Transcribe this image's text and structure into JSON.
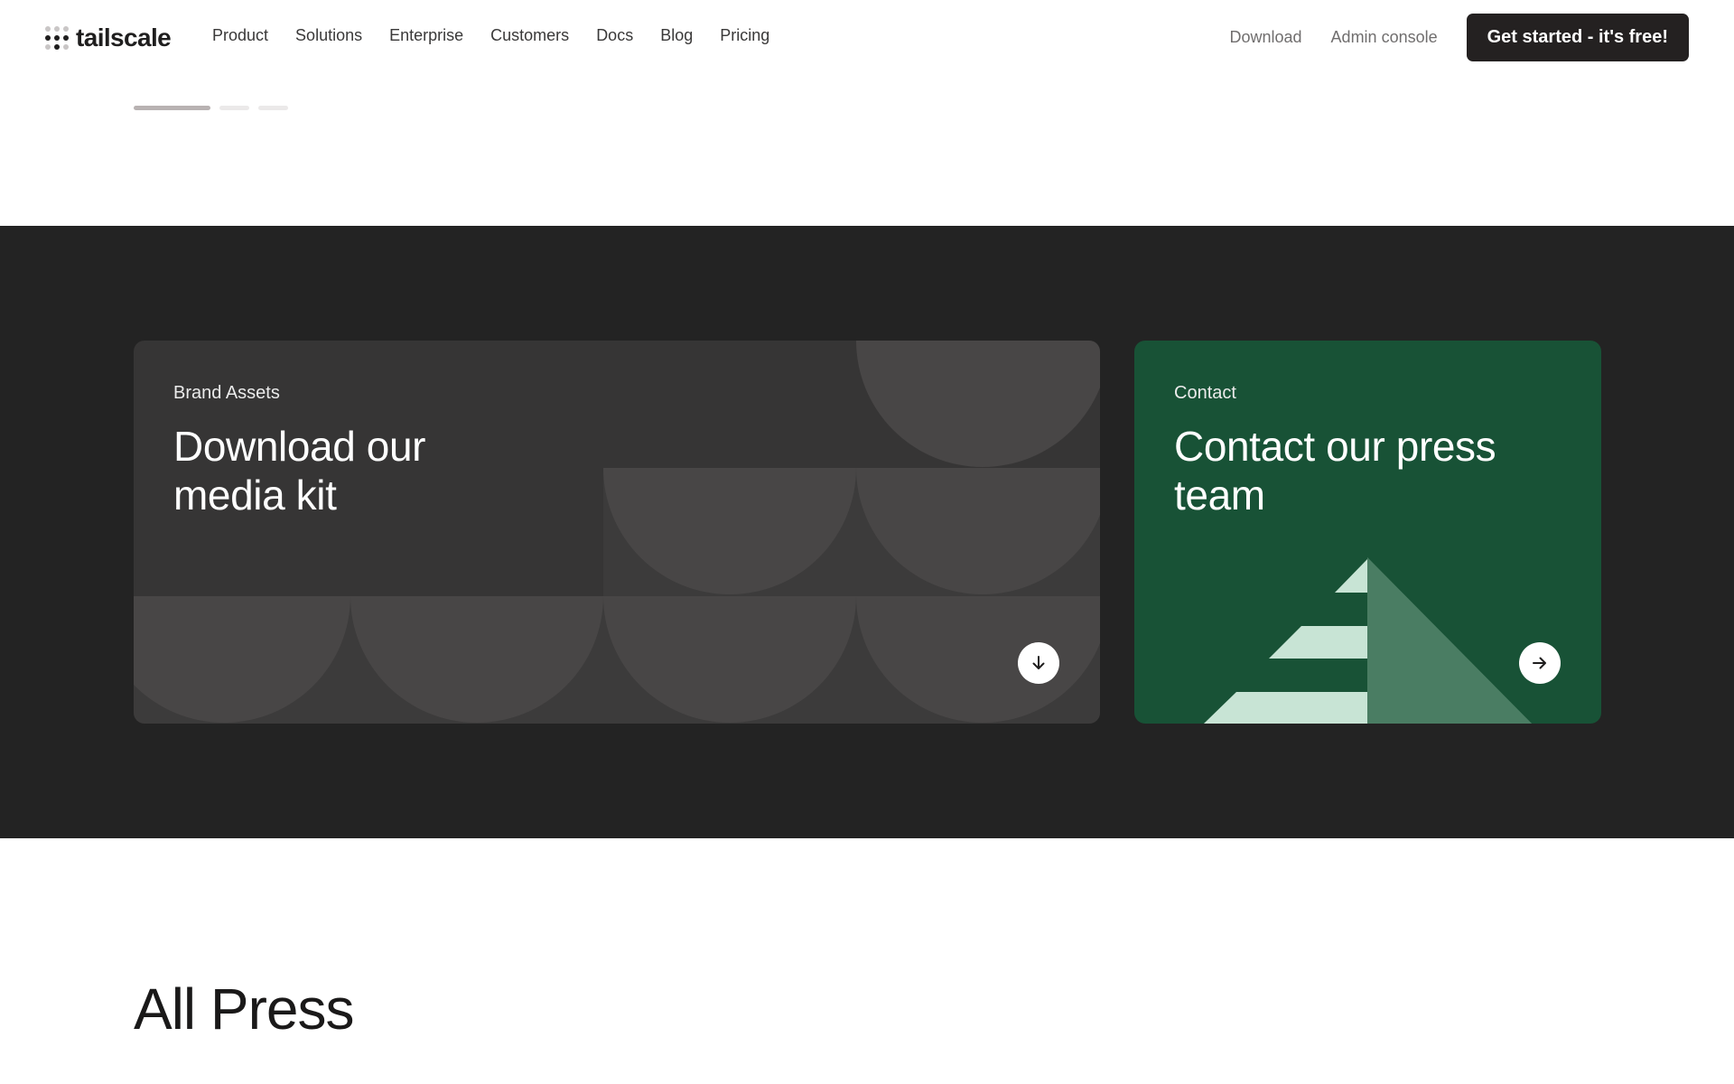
{
  "nav": {
    "logo_text": "tailscale",
    "links": [
      "Product",
      "Solutions",
      "Enterprise",
      "Customers",
      "Docs",
      "Blog",
      "Pricing"
    ],
    "download_label": "Download",
    "admin_label": "Admin console",
    "cta_label": "Get started - it's free!"
  },
  "carousel": {
    "slide_count": 3,
    "active_index": 0
  },
  "cards": {
    "media_kit": {
      "label": "Brand Assets",
      "title": "Download our media kit",
      "action_icon": "arrow-down-icon"
    },
    "contact": {
      "label": "Contact",
      "title": "Contact our press team",
      "action_icon": "arrow-right-icon"
    }
  },
  "all_press": {
    "title": "All Press"
  },
  "colors": {
    "dark_band": "#232323",
    "media_card": "#363535",
    "media_shapes": "#484646",
    "contact_card": "#185236",
    "contact_light": "#c8e4d5",
    "contact_mid": "#4a7d63",
    "cta": "#242121"
  }
}
